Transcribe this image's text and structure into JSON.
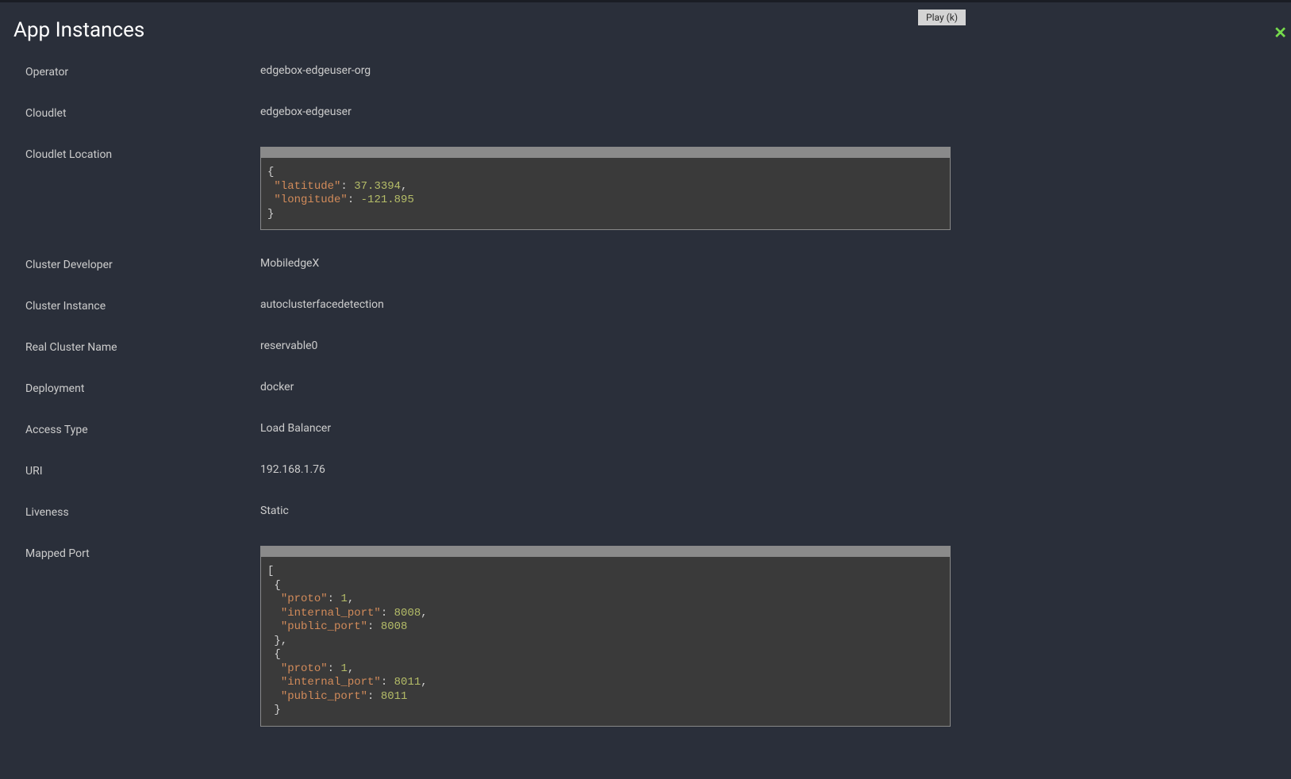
{
  "page": {
    "title": "App Instances",
    "play_button": "Play (k)"
  },
  "fields": {
    "operator": {
      "label": "Operator",
      "value": "edgebox-edgeuser-org"
    },
    "cloudlet": {
      "label": "Cloudlet",
      "value": "edgebox-edgeuser"
    },
    "cloudlet_location": {
      "label": "Cloudlet Location"
    },
    "cluster_developer": {
      "label": "Cluster Developer",
      "value": "MobiledgeX"
    },
    "cluster_instance": {
      "label": "Cluster Instance",
      "value": "autoclusterfacedetection"
    },
    "real_cluster_name": {
      "label": "Real Cluster Name",
      "value": "reservable0"
    },
    "deployment": {
      "label": "Deployment",
      "value": "docker"
    },
    "access_type": {
      "label": "Access Type",
      "value": "Load Balancer"
    },
    "uri": {
      "label": "URI",
      "value": "192.168.1.76"
    },
    "liveness": {
      "label": "Liveness",
      "value": "Static"
    },
    "mapped_port": {
      "label": "Mapped Port"
    }
  },
  "cloudlet_location_json": {
    "latitude": 37.3394,
    "longitude": -121.895
  },
  "mapped_port_json": [
    {
      "proto": 1,
      "internal_port": 8008,
      "public_port": 8008
    },
    {
      "proto": 1,
      "internal_port": 8011,
      "public_port": 8011
    }
  ],
  "code": {
    "loc_open": "{",
    "loc_lat_key": "\"latitude\"",
    "loc_lat_val": "37.3394",
    "loc_lon_key": "\"longitude\"",
    "loc_lon_val": "-121.895",
    "loc_close": "}",
    "mp_open": "[",
    "obj_open": "{",
    "proto_key": "\"proto\"",
    "proto_val": "1",
    "internal_key": "\"internal_port\"",
    "public_key": "\"public_port\"",
    "val_8008": "8008",
    "val_8011": "8011",
    "obj_close_comma": "},",
    "obj_close_partial": "}",
    "colon_sp": ": ",
    "comma": ","
  }
}
